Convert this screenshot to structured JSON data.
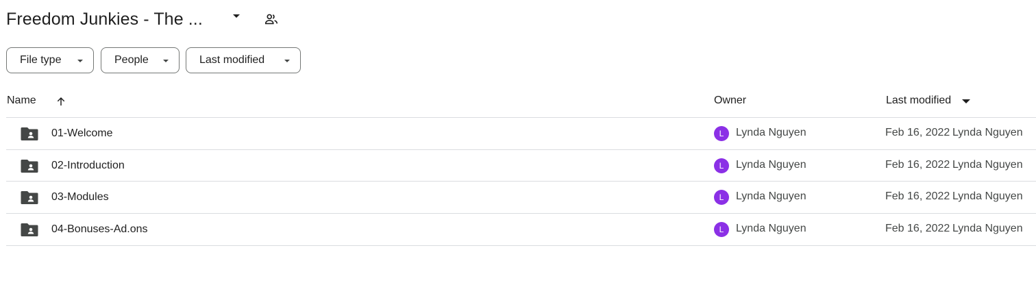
{
  "header": {
    "title": "Freedom Junkies - The ...",
    "title_menu_icon": "arrow-drop-down-icon",
    "shared_icon": "people-icon"
  },
  "filters": [
    {
      "label": "File type",
      "icon": "arrow-drop-down-icon"
    },
    {
      "label": "People",
      "icon": "arrow-drop-down-icon"
    },
    {
      "label": "Last modified",
      "icon": "arrow-drop-down-icon"
    }
  ],
  "table": {
    "columns": {
      "name": "Name",
      "owner": "Owner",
      "last_modified": "Last modified"
    },
    "sort_icons": {
      "name": "arrow-upward-icon",
      "last_modified": "arrow-drop-down-icon"
    },
    "rows": [
      {
        "icon": "shared-folder-icon",
        "name": "01-Welcome",
        "owner_initial": "L",
        "owner": "Lynda Nguyen",
        "modified_date": "Feb 16, 2022",
        "modified_by": "Lynda Nguyen"
      },
      {
        "icon": "shared-folder-icon",
        "name": "02-Introduction",
        "owner_initial": "L",
        "owner": "Lynda Nguyen",
        "modified_date": "Feb 16, 2022",
        "modified_by": "Lynda Nguyen"
      },
      {
        "icon": "shared-folder-icon",
        "name": "03-Modules",
        "owner_initial": "L",
        "owner": "Lynda Nguyen",
        "modified_date": "Feb 16, 2022",
        "modified_by": "Lynda Nguyen"
      },
      {
        "icon": "shared-folder-icon",
        "name": "04-Bonuses-Ad.ons",
        "owner_initial": "L",
        "owner": "Lynda Nguyen",
        "modified_date": "Feb 16, 2022",
        "modified_by": "Lynda Nguyen"
      }
    ]
  },
  "colors": {
    "avatar": "#8b30e6",
    "icon": "#444746",
    "divider": "#dadce0"
  }
}
